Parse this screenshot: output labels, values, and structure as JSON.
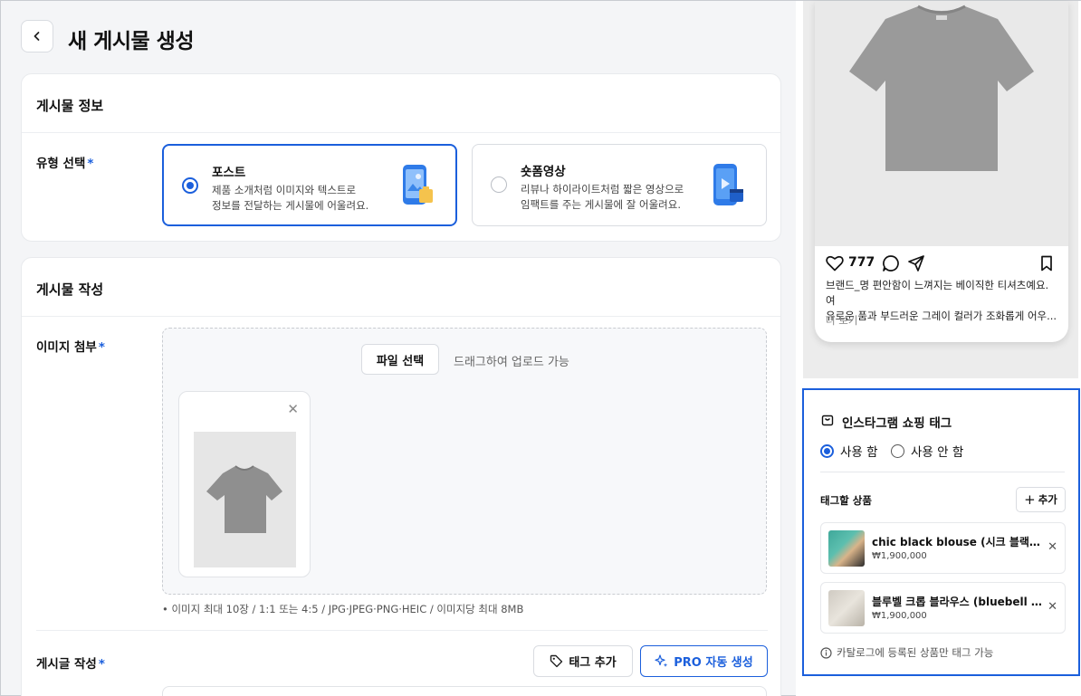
{
  "header": {
    "title": "새 게시물 생성",
    "back_icon": "chevron-left-icon"
  },
  "post_info": {
    "section_title": "게시물 정보",
    "type_label": "유형 선택",
    "required_mark": "*",
    "options": [
      {
        "title": "포스트",
        "desc_line1": "제품 소개처럼 이미지와 텍스트로",
        "desc_line2": "정보를 전달하는 게시물에 어울려요.",
        "selected": true,
        "icon": "phone-image-icon"
      },
      {
        "title": "숏폼영상",
        "desc_line1": "리뷰나 하이라이트처럼 짧은 영상으로",
        "desc_line2": "임팩트를 주는 게시물에 잘 어울려요.",
        "selected": false,
        "icon": "phone-video-icon"
      }
    ]
  },
  "compose": {
    "section_title": "게시물 작성",
    "image_label": "이미지 첨부",
    "file_button": "파일 선택",
    "drag_text": "드래그하여 업로드 가능",
    "image_hint": "이미지 최대 10장 / 1:1 또는 4:5 / JPG·JPEG·PNG·HEIC / 이미지당 최대 8MB",
    "text_label": "게시글 작성",
    "tag_button": "태그 추가",
    "pro_button": "PRO 자동 생성"
  },
  "preview": {
    "likes": "777",
    "caption_line1": "브랜드_명 편안함이 느껴지는 베이직한 티셔츠예요. 여",
    "caption_line2": "유로운 품과 부드러운 그레이 컬러가 조화롭게 어우...",
    "more": "더 보기"
  },
  "shopping": {
    "title": "인스타그램 쇼핑 태그",
    "use_label": "사용 함",
    "no_use_label": "사용 안 함",
    "selected": "사용 함",
    "products_label": "태그할 상품",
    "add_label": "추가",
    "products": [
      {
        "name": "chic black blouse (시크 블랙 블라...",
        "price": "₩1,900,000"
      },
      {
        "name": "블루벨 크롭 블라우스 (bluebell cro...",
        "price": "₩1,900,000"
      }
    ],
    "note": "카탈로그에 등록된 상품만 태그 가능"
  },
  "colors": {
    "accent": "#1b5fdc"
  }
}
